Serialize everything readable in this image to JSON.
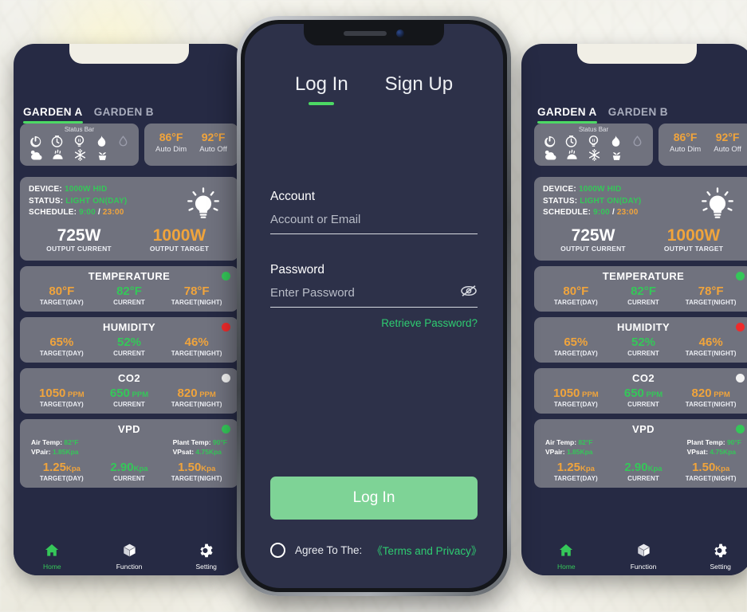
{
  "background": {
    "type": "blurred-photo",
    "tone": "#e8e6da"
  },
  "colors": {
    "screen_bg": "#2d3149",
    "card_bg": "#70727e",
    "accent_green": "#35c759",
    "accent_orange": "#f0a43c",
    "button_green": "#7ed396",
    "tab_underline": "#4cd964"
  },
  "login": {
    "tabs": [
      {
        "label": "Log In",
        "active": true
      },
      {
        "label": "Sign Up",
        "active": false
      }
    ],
    "account": {
      "label": "Account",
      "placeholder": "Account or Email",
      "value": ""
    },
    "password": {
      "label": "Password",
      "placeholder": "Enter Password",
      "value": "",
      "toggle_icon": "eye-off-icon"
    },
    "retrieve_password": "Retrieve Password?",
    "submit_label": "Log In",
    "agree": {
      "checked": false,
      "text": "Agree To The:",
      "link": "《Terms and Privacy》"
    }
  },
  "app": {
    "garden_tabs": [
      {
        "label": "GARDEN A",
        "active": true
      },
      {
        "label": "GARDEN B",
        "active": false
      }
    ],
    "status_bar": {
      "title": "Status Bar",
      "icons_row1": [
        "power-icon",
        "timer-icon",
        "bulb-sensor-icon",
        "flame-icon",
        "water-drop-icon"
      ],
      "icons_row2": [
        "cloud-sun-icon",
        "humidifier-icon",
        "snowflake-icon",
        "plant-pot-icon"
      ]
    },
    "auto_panel": [
      {
        "value": "86°F",
        "label": "Auto Dim"
      },
      {
        "value": "92°F",
        "label": "Auto Off"
      }
    ],
    "device": {
      "device_label": "DEVICE:",
      "device_value": "1000W HID",
      "status_label": "STATUS:",
      "status_value": "LIGHT ON(DAY)",
      "schedule_label": "SCHEDULE:",
      "schedule_on": "9:00",
      "schedule_sep": "/",
      "schedule_off": "23:00",
      "icon": "light-bulb-icon",
      "output_current": {
        "value": "725W",
        "label": "OUTPUT CURRENT"
      },
      "output_target": {
        "value": "1000W",
        "label": "OUTPUT TARGET"
      }
    },
    "metrics": [
      {
        "title": "TEMPERATURE",
        "dot": "#35c759",
        "day": {
          "value": "80°F",
          "unit": "",
          "label": "TARGET(DAY)"
        },
        "cur": {
          "value": "82°F",
          "unit": "",
          "label": "CURRENT"
        },
        "night": {
          "value": "78°F",
          "unit": "",
          "label": "TARGET(NIGHT)"
        }
      },
      {
        "title": "HUMIDITY",
        "dot": "#ef2b2b",
        "day": {
          "value": "65%",
          "unit": "",
          "label": "TARGET(DAY)"
        },
        "cur": {
          "value": "52%",
          "unit": "",
          "label": "CURRENT"
        },
        "night": {
          "value": "46%",
          "unit": "",
          "label": "TARGET(NIGHT)"
        }
      },
      {
        "title": "CO2",
        "dot": "#f2f2f2",
        "day": {
          "value": "1050",
          "unit": " PPM",
          "label": "TARGET(DAY)"
        },
        "cur": {
          "value": "650",
          "unit": " PPM",
          "label": "CURRENT"
        },
        "night": {
          "value": "820",
          "unit": " PPM",
          "label": "TARGET(NIGHT)"
        }
      }
    ],
    "vpd": {
      "title": "VPD",
      "dot": "#35c759",
      "air_temp_label": "Air Temp:",
      "air_temp_value": "82°F",
      "vpair_label": "VPair:",
      "vpair_value": "1.85Kpa",
      "plant_temp_label": "Plant Temp:",
      "plant_temp_value": "90°F",
      "vpsat_label": "VPsat:",
      "vpsat_value": "4.75Kpa",
      "day": {
        "value": "1.25",
        "unit": "Kpa",
        "label": "TARGET(DAY)"
      },
      "cur": {
        "value": "2.90",
        "unit": "Kpa",
        "label": "CURRENT"
      },
      "night": {
        "value": "1.50",
        "unit": "Kpa",
        "label": "TARGET(NIGHT)"
      }
    },
    "bottom_nav": [
      {
        "label": "Home",
        "icon": "home-icon",
        "active": true
      },
      {
        "label": "Function",
        "icon": "cube-icon",
        "active": false
      },
      {
        "label": "Setting",
        "icon": "gear-icon",
        "active": false
      }
    ]
  }
}
